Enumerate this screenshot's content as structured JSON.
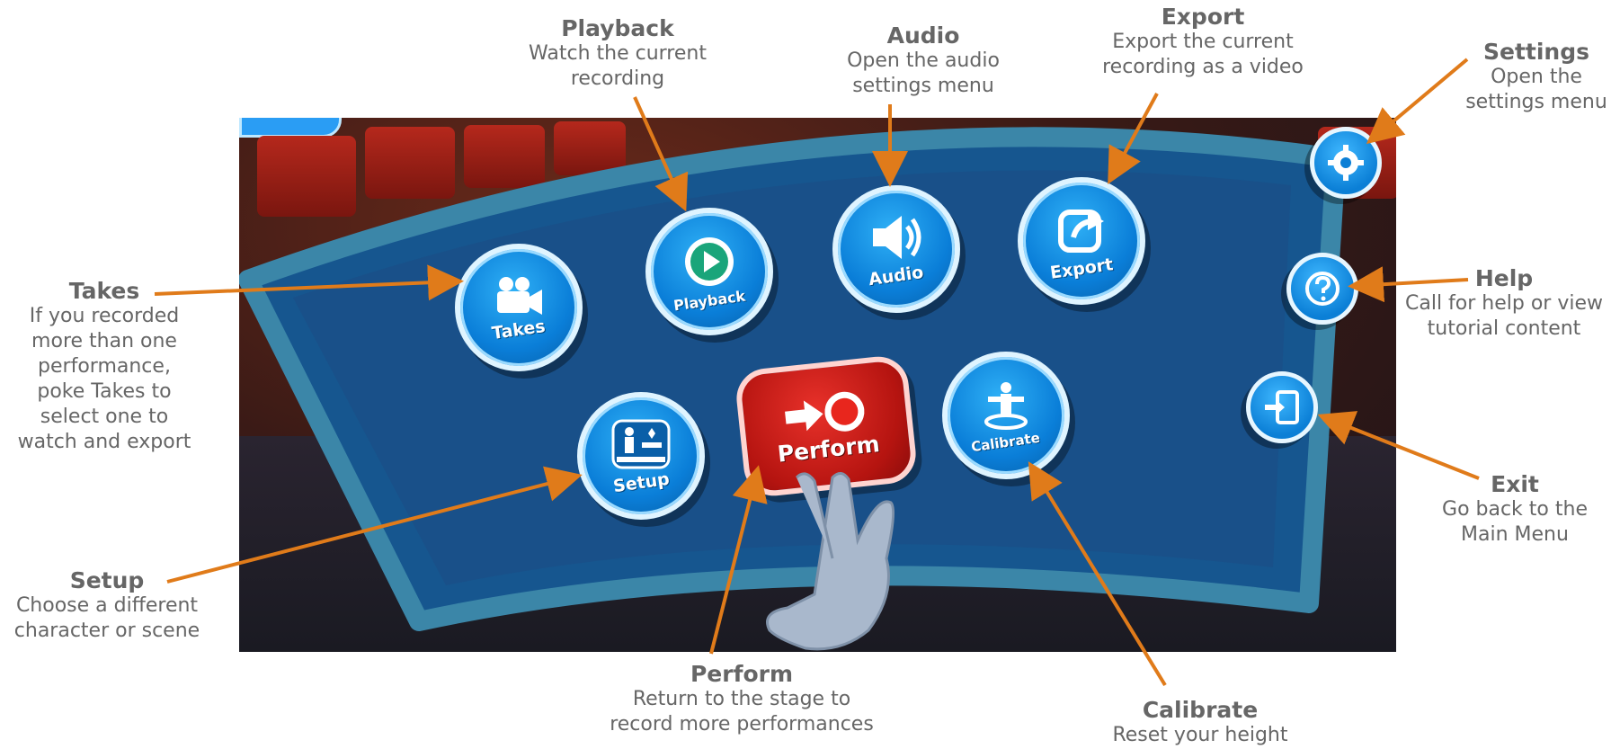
{
  "panel": {
    "buttons": {
      "takes": {
        "label": "Takes",
        "icon": "video-camera-icon"
      },
      "playback": {
        "label": "Playback",
        "icon": "play-icon"
      },
      "audio": {
        "label": "Audio",
        "icon": "speaker-icon"
      },
      "export": {
        "label": "Export",
        "icon": "share-export-icon"
      },
      "setup": {
        "label": "Setup",
        "icon": "setup-scene-icon"
      },
      "perform": {
        "label": "Perform",
        "icon": "arrow-record-icon"
      },
      "calibrate": {
        "label": "Calibrate",
        "icon": "calibrate-figure-icon"
      }
    },
    "side_buttons": {
      "settings": {
        "icon": "gear-icon"
      },
      "help": {
        "icon": "question-mark-icon"
      },
      "exit": {
        "icon": "exit-door-icon"
      }
    }
  },
  "annotations": {
    "playback": {
      "title": "Playback",
      "desc_lines": [
        "Watch the current",
        "recording"
      ]
    },
    "audio": {
      "title": "Audio",
      "desc_lines": [
        "Open the audio",
        "settings menu"
      ]
    },
    "export": {
      "title": "Export",
      "desc_lines": [
        "Export the current",
        "recording as a video"
      ]
    },
    "settings": {
      "title": "Settings",
      "desc_lines": [
        "Open the",
        "settings menu"
      ]
    },
    "takes": {
      "title": "Takes",
      "desc_lines": [
        "If you recorded",
        "more than one",
        "performance,",
        "poke Takes to",
        "select one to",
        "watch and export"
      ]
    },
    "help": {
      "title": "Help",
      "desc_lines": [
        "Call for help or view",
        "tutorial content"
      ]
    },
    "exit": {
      "title": "Exit",
      "desc_lines": [
        "Go back to the",
        "Main Menu"
      ]
    },
    "setup": {
      "title": "Setup",
      "desc_lines": [
        "Choose a different",
        "character or scene"
      ]
    },
    "perform": {
      "title": "Perform",
      "desc_lines": [
        "Return to the stage to",
        "record more performances"
      ]
    },
    "calibrate": {
      "title": "Calibrate",
      "desc_lines": [
        "Reset your height"
      ]
    }
  },
  "colors": {
    "arrow": "#e07b1a",
    "button_blue": "#0a7ed8",
    "perform_red": "#c4170f",
    "panel_blue": "#1f6fa8"
  }
}
